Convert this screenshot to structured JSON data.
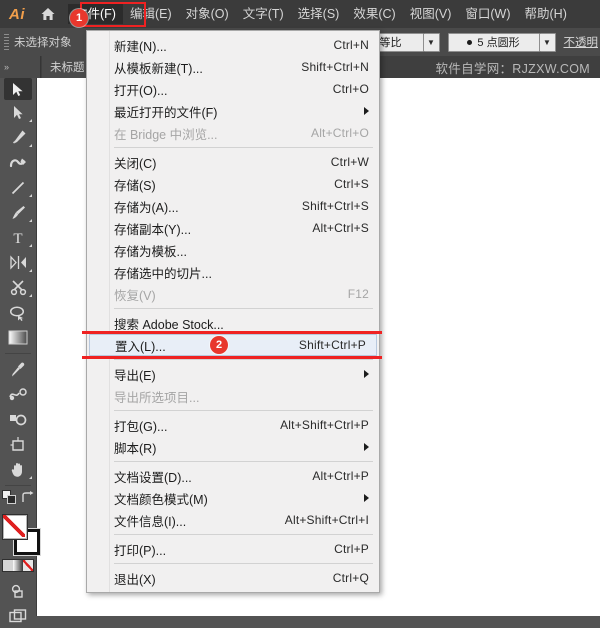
{
  "app": {
    "logo": "Ai",
    "home_icon": "home-icon"
  },
  "menubar": {
    "items": [
      {
        "label": "文件(F)",
        "active": true
      },
      {
        "label": "编辑(E)",
        "active": false
      },
      {
        "label": "对象(O)",
        "active": false
      },
      {
        "label": "文字(T)",
        "active": false
      },
      {
        "label": "选择(S)",
        "active": false
      },
      {
        "label": "效果(C)",
        "active": false
      },
      {
        "label": "视图(V)",
        "active": false
      },
      {
        "label": "窗口(W)",
        "active": false
      },
      {
        "label": "帮助(H)",
        "active": false
      }
    ]
  },
  "controlbar": {
    "selection_status": "未选择对象",
    "scale_combo": "等比",
    "brush_combo": "5 点圆形",
    "opacity_link": "不透明"
  },
  "document": {
    "panel_toggle_icon": "expand-panels-icon",
    "tab_title": "未标题",
    "watermark": "软件自学网：RJZXW.COM"
  },
  "tools": [
    {
      "name": "selection-tool",
      "selected": true,
      "has_flyout": false
    },
    {
      "name": "direct-selection-tool",
      "selected": false,
      "has_flyout": true
    },
    {
      "name": "pen-tool",
      "selected": false,
      "has_flyout": true
    },
    {
      "name": "curvature-tool",
      "selected": false,
      "has_flyout": false
    },
    {
      "name": "line-segment-tool",
      "selected": false,
      "has_flyout": true
    },
    {
      "name": "paintbrush-tool",
      "selected": false,
      "has_flyout": true
    },
    {
      "name": "type-tool",
      "selected": false,
      "has_flyout": true
    },
    {
      "name": "reflect-tool",
      "selected": false,
      "has_flyout": true
    },
    {
      "name": "scissors-tool",
      "selected": false,
      "has_flyout": true
    },
    {
      "name": "lasso-select-tool",
      "selected": false,
      "has_flyout": false
    },
    {
      "name": "gradient-tool",
      "selected": false,
      "has_flyout": false
    },
    {
      "name": "eyedropper-tool",
      "selected": false,
      "has_flyout": false
    },
    {
      "name": "blend-tool",
      "selected": false,
      "has_flyout": false
    },
    {
      "name": "shape-builder-tool",
      "selected": false,
      "has_flyout": false
    },
    {
      "name": "artboard-tool",
      "selected": false,
      "has_flyout": false
    },
    {
      "name": "hand-tool",
      "selected": false,
      "has_flyout": true
    }
  ],
  "file_menu": {
    "groups": [
      [
        {
          "label": "新建(N)...",
          "accel": "Ctrl+N",
          "disabled": false,
          "submenu": false,
          "highlight": false
        },
        {
          "label": "从模板新建(T)...",
          "accel": "Shift+Ctrl+N",
          "disabled": false,
          "submenu": false,
          "highlight": false
        },
        {
          "label": "打开(O)...",
          "accel": "Ctrl+O",
          "disabled": false,
          "submenu": false,
          "highlight": false
        },
        {
          "label": "最近打开的文件(F)",
          "accel": "",
          "disabled": false,
          "submenu": true,
          "highlight": false
        },
        {
          "label": "在 Bridge 中浏览...",
          "accel": "Alt+Ctrl+O",
          "disabled": true,
          "submenu": false,
          "highlight": false
        }
      ],
      [
        {
          "label": "关闭(C)",
          "accel": "Ctrl+W",
          "disabled": false,
          "submenu": false,
          "highlight": false
        },
        {
          "label": "存储(S)",
          "accel": "Ctrl+S",
          "disabled": false,
          "submenu": false,
          "highlight": false
        },
        {
          "label": "存储为(A)...",
          "accel": "Shift+Ctrl+S",
          "disabled": false,
          "submenu": false,
          "highlight": false
        },
        {
          "label": "存储副本(Y)...",
          "accel": "Alt+Ctrl+S",
          "disabled": false,
          "submenu": false,
          "highlight": false
        },
        {
          "label": "存储为模板...",
          "accel": "",
          "disabled": false,
          "submenu": false,
          "highlight": false
        },
        {
          "label": "存储选中的切片...",
          "accel": "",
          "disabled": false,
          "submenu": false,
          "highlight": false
        },
        {
          "label": "恢复(V)",
          "accel": "F12",
          "disabled": true,
          "submenu": false,
          "highlight": false
        }
      ],
      [
        {
          "label": "搜索 Adobe Stock...",
          "accel": "",
          "disabled": false,
          "submenu": false,
          "highlight": false
        },
        {
          "label": "置入(L)...",
          "accel": "Shift+Ctrl+P",
          "disabled": false,
          "submenu": false,
          "highlight": true
        }
      ],
      [
        {
          "label": "导出(E)",
          "accel": "",
          "disabled": false,
          "submenu": true,
          "highlight": false
        },
        {
          "label": "导出所选项目...",
          "accel": "",
          "disabled": true,
          "submenu": false,
          "highlight": false
        }
      ],
      [
        {
          "label": "打包(G)...",
          "accel": "Alt+Shift+Ctrl+P",
          "disabled": false,
          "submenu": false,
          "highlight": false
        },
        {
          "label": "脚本(R)",
          "accel": "",
          "disabled": false,
          "submenu": true,
          "highlight": false
        }
      ],
      [
        {
          "label": "文档设置(D)...",
          "accel": "Alt+Ctrl+P",
          "disabled": false,
          "submenu": false,
          "highlight": false
        },
        {
          "label": "文档颜色模式(M)",
          "accel": "",
          "disabled": false,
          "submenu": true,
          "highlight": false
        },
        {
          "label": "文件信息(I)...",
          "accel": "Alt+Shift+Ctrl+I",
          "disabled": false,
          "submenu": false,
          "highlight": false
        }
      ],
      [
        {
          "label": "打印(P)...",
          "accel": "Ctrl+P",
          "disabled": false,
          "submenu": false,
          "highlight": false
        }
      ],
      [
        {
          "label": "退出(X)",
          "accel": "Ctrl+Q",
          "disabled": false,
          "submenu": false,
          "highlight": false
        }
      ]
    ]
  },
  "annotations": {
    "accent_color": "#ef2222",
    "badge_color": "#e8372d",
    "step1_badge": "1",
    "step2_badge": "2"
  }
}
